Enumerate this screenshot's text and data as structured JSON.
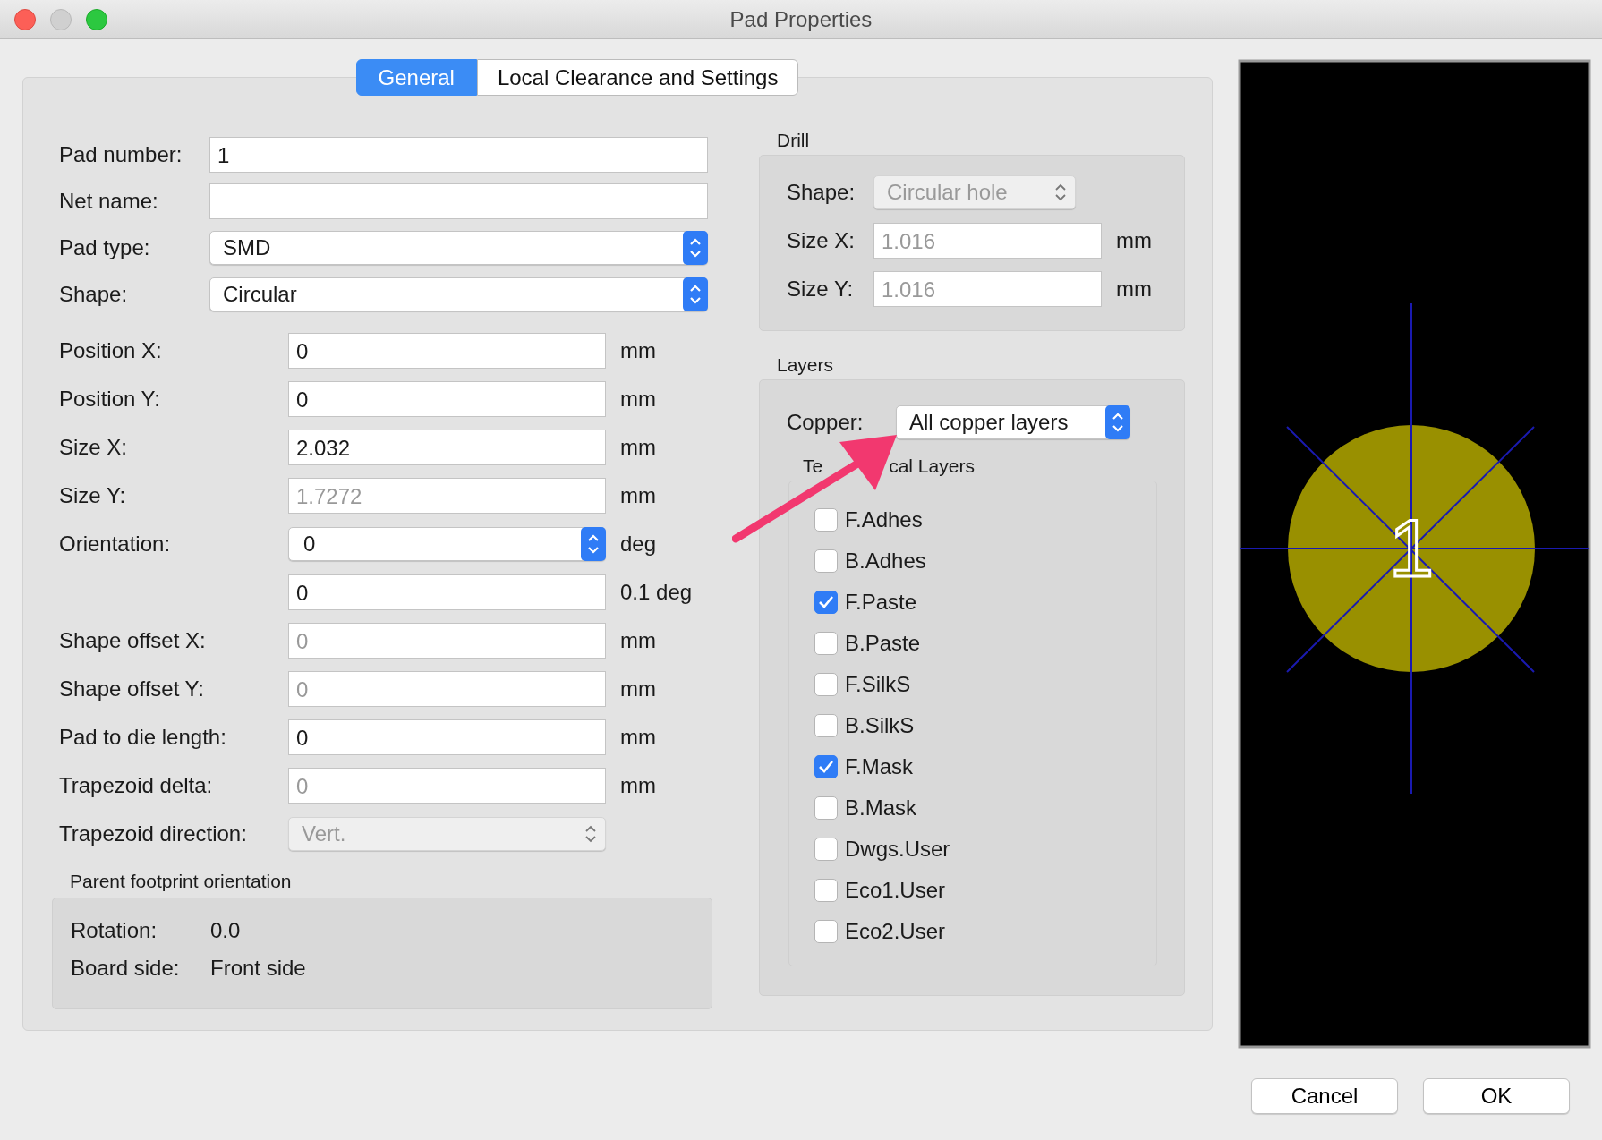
{
  "window": {
    "title": "Pad Properties"
  },
  "tabs": [
    {
      "label": "General",
      "selected": true
    },
    {
      "label": "Local Clearance and Settings",
      "selected": false
    }
  ],
  "pad_fields": [
    {
      "label": "Pad number:",
      "kind": "text",
      "value": "1",
      "disabled": false
    },
    {
      "label": "Net name:",
      "kind": "text"
    },
    {
      "label": "Pad type:",
      "kind": "select",
      "value": "SMD",
      "disabled": false
    },
    {
      "label": "Shape:",
      "kind": "select",
      "value": "Circular",
      "disabled": false
    }
  ],
  "geometry_fields": [
    {
      "label": "Position X:",
      "kind": "text",
      "value": "0",
      "unit": "mm",
      "disabled": false
    },
    {
      "label": "Position Y:",
      "kind": "text",
      "value": "0",
      "unit": "mm",
      "disabled": false
    },
    {
      "label": "Size X:",
      "kind": "text",
      "value": "2.032",
      "unit": "mm",
      "disabled": false
    },
    {
      "label": "Size Y:",
      "kind": "text",
      "value": "1.7272",
      "unit": "mm",
      "disabled": true
    },
    {
      "label": "Orientation:",
      "kind": "combo",
      "value": "0",
      "unit": "deg",
      "disabled": false
    },
    {
      "kind": "text",
      "value": "0",
      "unit": "0.1 deg",
      "disabled": false
    },
    {
      "label": "Shape offset X:",
      "kind": "text",
      "value": "0",
      "unit": "mm",
      "disabled": true
    },
    {
      "label": "Shape offset Y:",
      "kind": "text",
      "value": "0",
      "unit": "mm",
      "disabled": true
    },
    {
      "label": "Pad to die length:",
      "kind": "text",
      "value": "0",
      "unit": "mm",
      "disabled": false
    },
    {
      "label": "Trapezoid delta:",
      "kind": "text",
      "value": "0",
      "unit": "mm",
      "disabled": true
    },
    {
      "label": "Trapezoid direction:",
      "kind": "select",
      "value": "Vert.",
      "disabled": true
    }
  ],
  "parent_footprint": {
    "title": "Parent footprint orientation",
    "rows": [
      {
        "label": "Rotation:",
        "value": "0.0"
      },
      {
        "label": "Board side:",
        "value": "Front side"
      }
    ]
  },
  "drill": {
    "title": "Drill",
    "fields": [
      {
        "label": "Shape:",
        "kind": "select",
        "value": "Circular hole",
        "disabled": true
      },
      {
        "label": "Size X:",
        "kind": "text",
        "value": "1.016",
        "unit": "mm",
        "disabled": true
      },
      {
        "label": "Size Y:",
        "kind": "text",
        "value": "1.016",
        "unit": "mm",
        "disabled": true
      }
    ]
  },
  "layers": {
    "title": "Layers",
    "copper": {
      "label": "Copper:",
      "value": "All copper layers"
    },
    "technical_title_parts": [
      "Te",
      "cal Layers"
    ],
    "technical": [
      {
        "label": "F.Adhes",
        "checked": false
      },
      {
        "label": "B.Adhes",
        "checked": false
      },
      {
        "label": "F.Paste",
        "checked": true
      },
      {
        "label": "B.Paste",
        "checked": false
      },
      {
        "label": "F.SilkS",
        "checked": false
      },
      {
        "label": "B.SilkS",
        "checked": false
      },
      {
        "label": "F.Mask",
        "checked": true
      },
      {
        "label": "B.Mask",
        "checked": false
      },
      {
        "label": "Dwgs.User",
        "checked": false
      },
      {
        "label": "Eco1.User",
        "checked": false
      },
      {
        "label": "Eco2.User",
        "checked": false
      }
    ]
  },
  "preview": {
    "pad_label": "1"
  },
  "buttons": [
    "Cancel",
    "OK"
  ]
}
